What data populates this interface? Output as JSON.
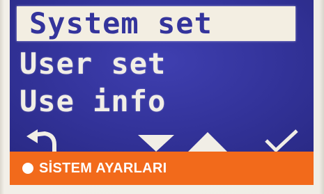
{
  "menu": {
    "items": [
      {
        "label": "System set",
        "selected": true
      },
      {
        "label": "User set",
        "selected": false
      },
      {
        "label": "Use info",
        "selected": false
      }
    ]
  },
  "softkeys": {
    "back_icon": "back-arrow-icon",
    "down_icon": "down-triangle-icon",
    "up_icon": "up-triangle-icon",
    "ok_icon": "checkmark-icon"
  },
  "caption": {
    "text": "SİSTEM AYARLARI"
  },
  "colors": {
    "screen_background": "#33339a",
    "menu_text": "#f1eee6",
    "selection_highlight": "#f3eee2",
    "selection_text": "#34349c",
    "caption_background": "#f26a1b",
    "caption_text": "#ffffff"
  }
}
